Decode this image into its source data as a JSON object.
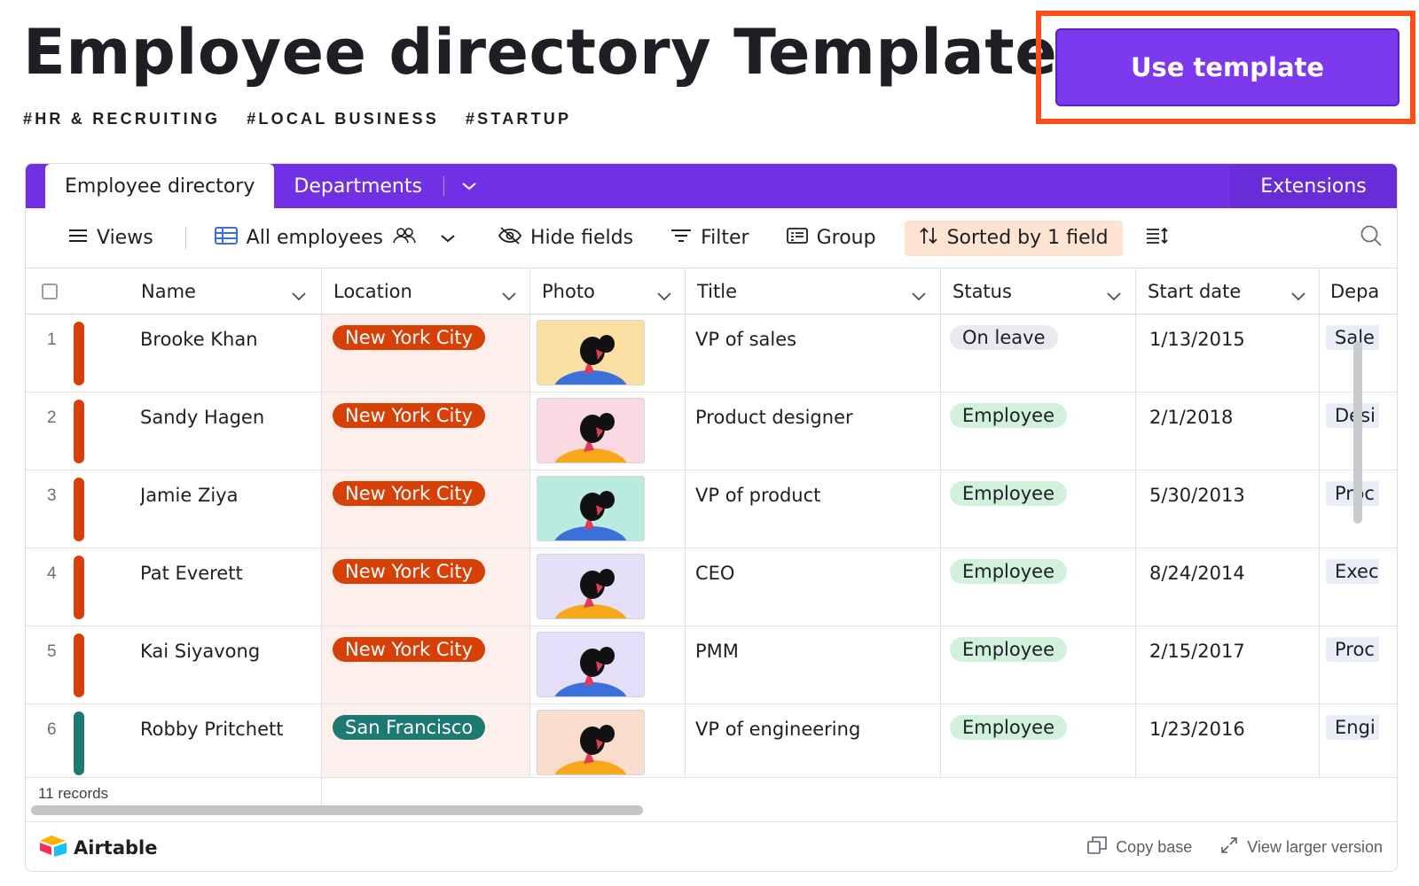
{
  "header": {
    "title": "Employee directory Template",
    "tags": [
      "#HR & RECRUITING",
      "#LOCAL BUSINESS",
      "#STARTUP"
    ],
    "cta_label": "Use template"
  },
  "tabbar": {
    "active_tab": "Employee directory",
    "tabs": [
      "Departments"
    ],
    "extensions_label": "Extensions"
  },
  "toolbar": {
    "views_label": "Views",
    "view_name": "All employees",
    "hide_fields_label": "Hide fields",
    "filter_label": "Filter",
    "group_label": "Group",
    "sorted_label": "Sorted by 1 field"
  },
  "table": {
    "columns": [
      "Name",
      "Location",
      "Photo",
      "Title",
      "Status",
      "Start date",
      "Depa"
    ],
    "rows": [
      {
        "num": "1",
        "name": "Brooke Khan",
        "location": "New York City",
        "title": "VP of sales",
        "status": "On leave",
        "start": "1/13/2015",
        "dept": "Sale",
        "bar": "#d74108",
        "loc_color": "#d74108",
        "status_color": "#e8eaef",
        "photo_bg": "#fbe0a4"
      },
      {
        "num": "2",
        "name": "Sandy Hagen",
        "location": "New York City",
        "title": "Product designer",
        "status": "Employee",
        "start": "2/1/2018",
        "dept": "Desi",
        "bar": "#d74108",
        "loc_color": "#d74108",
        "status_color": "#d1f2da",
        "photo_bg": "#fbd9e3"
      },
      {
        "num": "3",
        "name": "Jamie Ziya",
        "location": "New York City",
        "title": "VP of product",
        "status": "Employee",
        "start": "5/30/2013",
        "dept": "Proc",
        "bar": "#d74108",
        "loc_color": "#d74108",
        "status_color": "#d1f2da",
        "photo_bg": "#b9ecdf"
      },
      {
        "num": "4",
        "name": "Pat Everett",
        "location": "New York City",
        "title": "CEO",
        "status": "Employee",
        "start": "8/24/2014",
        "dept": "Exec",
        "bar": "#d74108",
        "loc_color": "#d74108",
        "status_color": "#d1f2da",
        "photo_bg": "#e5e0f8"
      },
      {
        "num": "5",
        "name": "Kai Siyavong",
        "location": "New York City",
        "title": "PMM",
        "status": "Employee",
        "start": "2/15/2017",
        "dept": "Proc",
        "bar": "#d74108",
        "loc_color": "#d74108",
        "status_color": "#d1f2da",
        "photo_bg": "#e4def8"
      },
      {
        "num": "6",
        "name": "Robby Pritchett",
        "location": "San Francisco",
        "title": "VP of engineering",
        "status": "Employee",
        "start": "1/23/2016",
        "dept": "Engi",
        "bar": "#1c7a73",
        "loc_color": "#1c7a73",
        "status_color": "#d1f2da",
        "photo_bg": "#fadccd"
      }
    ],
    "record_count": "11 records"
  },
  "footer": {
    "brand": "Airtable",
    "copy_base": "Copy base",
    "view_larger": "View larger version"
  },
  "colors": {
    "accent": "#7130e3",
    "cta": "#7c39ed",
    "highlight_frame": "#ff4d1a"
  }
}
